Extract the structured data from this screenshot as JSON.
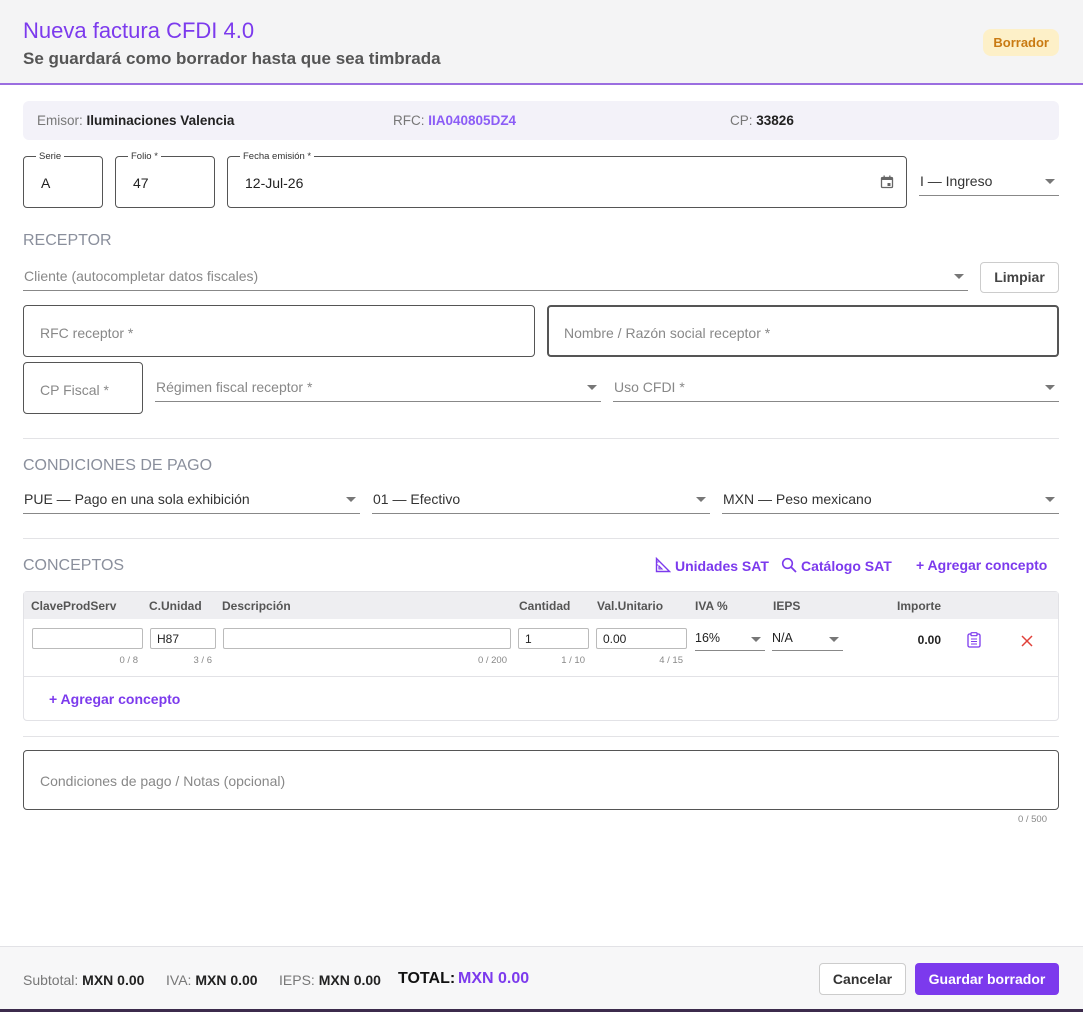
{
  "header": {
    "title": "Nueva factura CFDI 4.0",
    "subtitle": "Se guardará como borrador hasta que sea timbrada",
    "badge": "Borrador"
  },
  "emisor": {
    "emisor_label": "Emisor:",
    "emisor_value": "Iluminaciones Valencia",
    "rfc_label": "RFC:",
    "rfc_value": "IIA040805DZ4",
    "cp_label": "CP:",
    "cp_value": "33826"
  },
  "doc": {
    "serie_label": "Serie",
    "serie_value": "A",
    "folio_label": "Folio *",
    "folio_value": "47",
    "fecha_label": "Fecha emisión *",
    "fecha_value": "12-Jul-26",
    "tipo_value": "I — Ingreso"
  },
  "receptor": {
    "section": "RECEPTOR",
    "cliente_placeholder": "Cliente (autocompletar datos fiscales)",
    "limpiar": "Limpiar",
    "rfc_placeholder": "RFC receptor *",
    "nombre_placeholder": "Nombre / Razón social receptor *",
    "cp_placeholder": "CP Fiscal *",
    "regimen_placeholder": "Régimen fiscal receptor *",
    "uso_placeholder": "Uso CFDI *"
  },
  "pago": {
    "section": "CONDICIONES DE PAGO",
    "metodo": "PUE — Pago en una sola exhibición",
    "forma": "01 — Efectivo",
    "moneda": "MXN — Peso mexicano"
  },
  "conceptos": {
    "section": "CONCEPTOS",
    "unidades_sat": "Unidades SAT",
    "catalogo_sat": "Catálogo SAT",
    "agregar_top": "+ Agregar concepto",
    "agregar_bottom": "+ Agregar concepto",
    "columns": [
      "ClaveProdServ",
      "C.Unidad",
      "Descripción",
      "Cantidad",
      "Val.Unitario",
      "IVA %",
      "IEPS",
      "Importe"
    ],
    "row": {
      "clave": "",
      "clave_count": "0 / 8",
      "unidad": "H87",
      "unidad_count": "3 / 6",
      "descripcion": "",
      "descripcion_count": "0 / 200",
      "cantidad": "1",
      "cantidad_count": "1 / 10",
      "valor": "0.00",
      "valor_count": "4 / 15",
      "iva": "16%",
      "ieps": "N/A",
      "importe": "0.00"
    }
  },
  "notas": {
    "placeholder": "Condiciones de pago / Notas (opcional)",
    "count": "0 / 500"
  },
  "footer": {
    "subtotal_label": "Subtotal:",
    "subtotal_value": "MXN 0.00",
    "iva_label": "IVA:",
    "iva_value": "MXN 0.00",
    "ieps_label": "IEPS:",
    "ieps_value": "MXN 0.00",
    "total_label": "TOTAL:",
    "total_value": "MXN 0.00",
    "cancel": "Cancelar",
    "save": "Guardar borrador"
  },
  "colors": {
    "accent": "#7c3aed",
    "badge_bg": "#fdf0c8",
    "badge_text": "#c97a12",
    "delete": "#e0413a"
  }
}
